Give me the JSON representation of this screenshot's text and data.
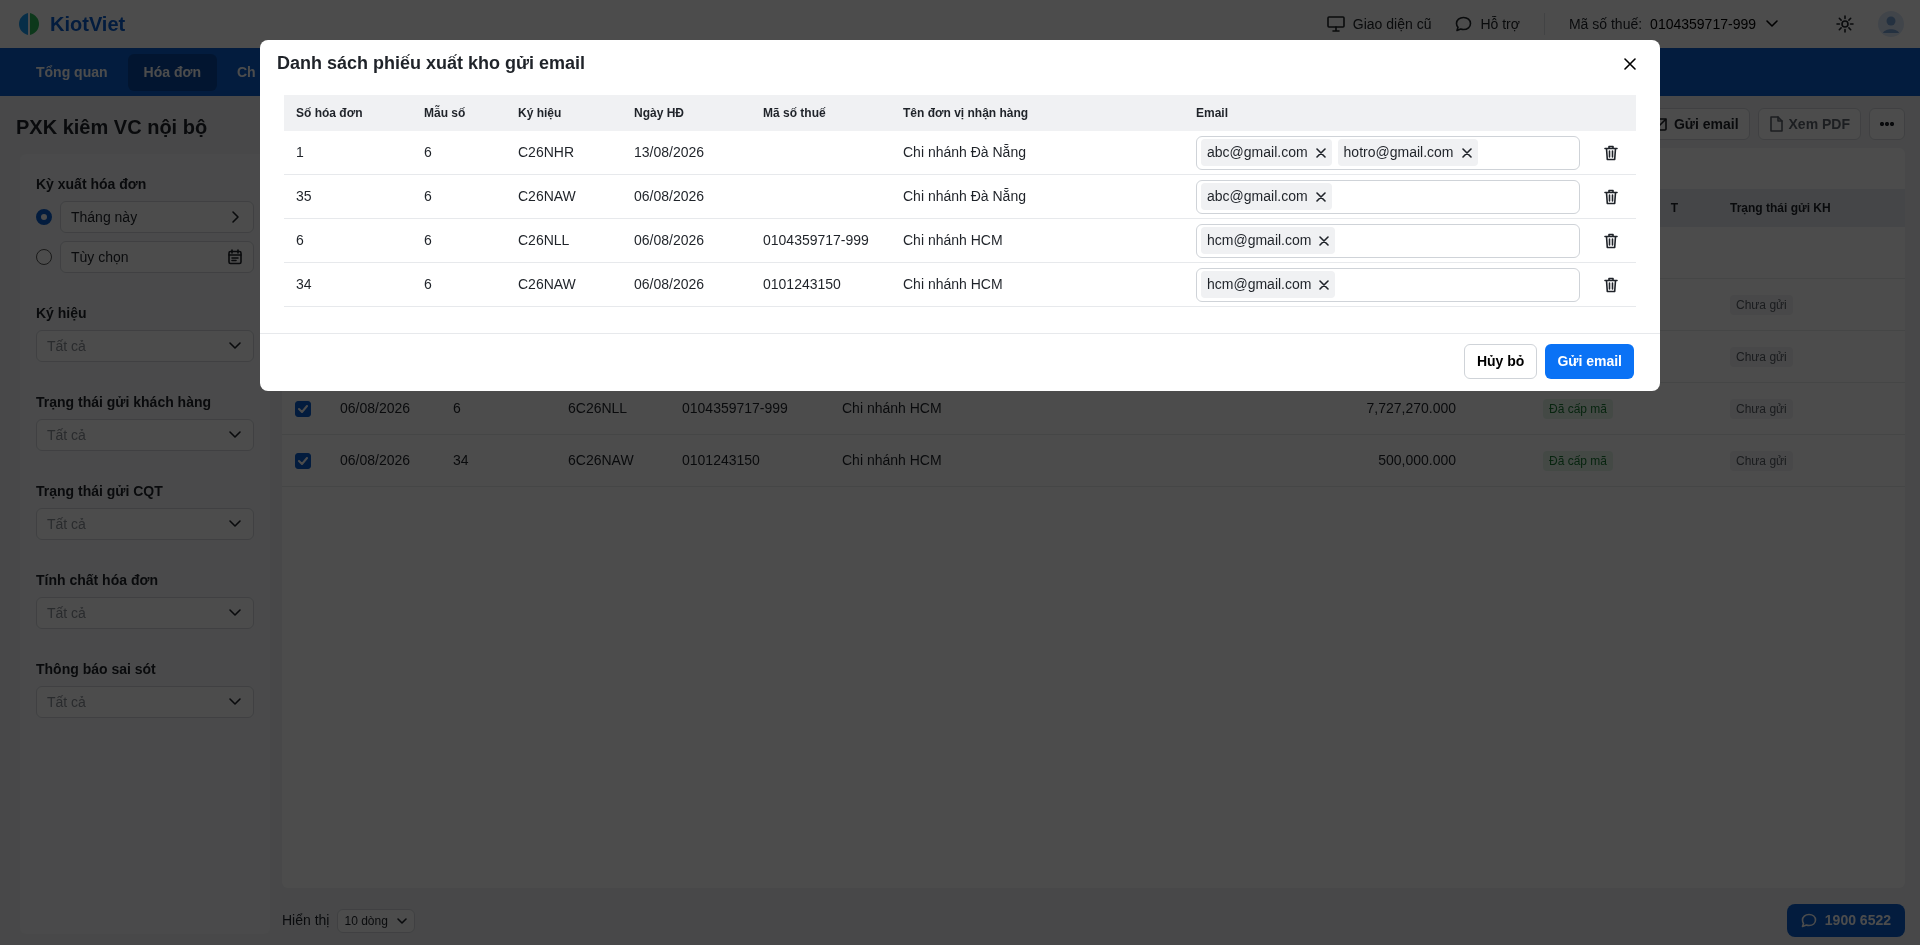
{
  "header": {
    "brand": "KiotViet",
    "links": [
      {
        "label": "Giao diện cũ",
        "kind": "monitor"
      },
      {
        "label": "Hỗ trợ",
        "kind": "chat"
      }
    ],
    "tax_label": "Mã số thuế:",
    "tax_code": "0104359717-999"
  },
  "nav": [
    {
      "label": "Tổng quan",
      "selected": false
    },
    {
      "label": "Hóa đơn",
      "selected": true
    },
    {
      "label": "Ch",
      "selected": false
    }
  ],
  "page_title": "PXK kiêm VC nội bộ",
  "filters": {
    "period": {
      "label": "Kỳ xuất hóa đơn",
      "options": [
        {
          "label": "Tháng này",
          "selected": true,
          "kind": "preset"
        },
        {
          "label": "Tùy chọn",
          "selected": false,
          "kind": "custom"
        }
      ]
    },
    "selects": [
      {
        "label": "Ký hiệu",
        "placeholder": "Tất cả"
      },
      {
        "label": "Trạng thái gửi khách hàng",
        "placeholder": "Tất cả"
      },
      {
        "label": "Trạng thái gửi CQT",
        "placeholder": "Tất cả"
      },
      {
        "label": "Tính chất hóa đơn",
        "placeholder": "Tất cả"
      },
      {
        "label": "Thông báo sai sót",
        "placeholder": "Tất cả"
      }
    ]
  },
  "toolbar": [
    {
      "label": "Gửi email",
      "kind": "email"
    },
    {
      "label": "Xem PDF",
      "kind": "pdf"
    },
    {
      "kind": "more"
    }
  ],
  "invoice_table": {
    "columns": [
      {
        "label": "T",
        "kind": "status"
      },
      {
        "label": "Trạng thái gửi KH",
        "kind": "customer_status"
      }
    ],
    "rows": [
      {},
      {
        "customer_status": "Chưa gửi"
      },
      {
        "customer_status": "Chưa gửi"
      },
      {
        "checked": true,
        "date": "06/08/2026",
        "number": "6",
        "symbol": "6C26NLL",
        "tax_code": "0104359717-999",
        "name": "Chi nhánh HCM",
        "amount": "7,727,270.000",
        "status": "Đã cấp mã",
        "customer_status": "Chưa gửi"
      },
      {
        "checked": true,
        "date": "06/08/2026",
        "number": "34",
        "symbol": "6C26NAW",
        "tax_code": "0101243150",
        "name": "Chi nhánh HCM",
        "amount": "500,000.000",
        "status": "Đã cấp mã",
        "customer_status": "Chưa gửi"
      }
    ]
  },
  "footer": {
    "page_size_label": "Hiển thị",
    "page_size": "10 dòng",
    "hotline": "1900 6522"
  },
  "dialog": {
    "title": "Danh sách phiếu xuất kho gửi email",
    "columns": [
      "Số hóa đơn",
      "Mẫu số",
      "Ký hiệu",
      "Ngày HĐ",
      "Mã số thuế",
      "Tên đơn vị nhận hàng",
      "Email"
    ],
    "rows": [
      {
        "cells": [
          "1",
          "6",
          "C26NHR",
          "13/08/2026",
          "",
          "Chi nhánh Đà Nẵng"
        ],
        "emails": [
          "abc@gmail.com",
          "hotro@gmail.com"
        ]
      },
      {
        "cells": [
          "35",
          "6",
          "C26NAW",
          "06/08/2026",
          "",
          "Chi nhánh Đà Nẵng"
        ],
        "emails": [
          "abc@gmail.com"
        ]
      },
      {
        "cells": [
          "6",
          "6",
          "C26NLL",
          "06/08/2026",
          "0104359717-999",
          "Chi nhánh HCM"
        ],
        "emails": [
          "hcm@gmail.com"
        ]
      },
      {
        "cells": [
          "34",
          "6",
          "C26NAW",
          "06/08/2026",
          "0101243150",
          "Chi nhánh HCM"
        ],
        "emails": [
          "hcm@gmail.com"
        ]
      }
    ],
    "buttons": [
      {
        "label": "Hủy bỏ",
        "kind": "secondary"
      },
      {
        "label": "Gửi email",
        "kind": "primary"
      }
    ]
  }
}
